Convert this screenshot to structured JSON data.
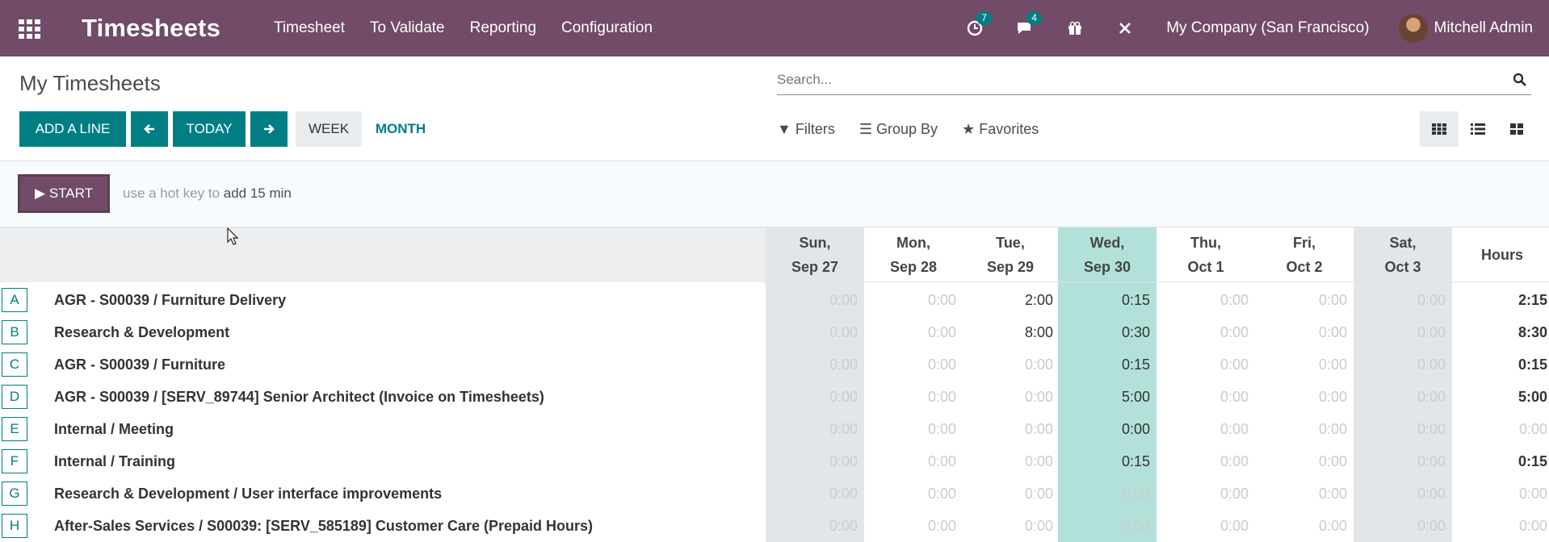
{
  "navbar": {
    "app_title": "Timesheets",
    "menu": [
      "Timesheet",
      "To Validate",
      "Reporting",
      "Configuration"
    ],
    "activity_count": "7",
    "messages_count": "4",
    "company": "My Company (San Francisco)",
    "user": "Mitchell Admin"
  },
  "control": {
    "title": "My Timesheets",
    "search_placeholder": "Search...",
    "add_line": "ADD A LINE",
    "today": "TODAY",
    "week": "WEEK",
    "month": "MONTH",
    "filters": "Filters",
    "group_by": "Group By",
    "favorites": "Favorites"
  },
  "timer": {
    "start": "START",
    "hint_prefix": "use a hot key to",
    "hint_action": "add 15 min"
  },
  "grid": {
    "days": [
      {
        "day": "Sun,",
        "date": "Sep 27"
      },
      {
        "day": "Mon,",
        "date": "Sep 28"
      },
      {
        "day": "Tue,",
        "date": "Sep 29"
      },
      {
        "day": "Wed,",
        "date": "Sep 30"
      },
      {
        "day": "Thu,",
        "date": "Oct 1"
      },
      {
        "day": "Fri,",
        "date": "Oct 2"
      },
      {
        "day": "Sat,",
        "date": "Oct 3"
      }
    ],
    "hours_header": "Hours",
    "rows": [
      {
        "key": "A",
        "label": "AGR - S00039  /  Furniture Delivery",
        "cells": [
          "0:00",
          "0:00",
          "2:00",
          "0:15",
          "0:00",
          "0:00",
          "0:00"
        ],
        "total": "2:15"
      },
      {
        "key": "B",
        "label": "Research & Development",
        "cells": [
          "0:00",
          "0:00",
          "8:00",
          "0:30",
          "0:00",
          "0:00",
          "0:00"
        ],
        "total": "8:30"
      },
      {
        "key": "C",
        "label": "AGR - S00039  /  Furniture",
        "cells": [
          "0:00",
          "0:00",
          "0:00",
          "0:15",
          "0:00",
          "0:00",
          "0:00"
        ],
        "total": "0:15"
      },
      {
        "key": "D",
        "label": "AGR - S00039 / [SERV_89744] Senior Architect (Invoice on Timesheets)",
        "cells": [
          "0:00",
          "0:00",
          "0:00",
          "5:00",
          "0:00",
          "0:00",
          "0:00"
        ],
        "total": "5:00"
      },
      {
        "key": "E",
        "label": "Internal  /  Meeting",
        "cells": [
          "0:00",
          "0:00",
          "0:00",
          "0:00",
          "0:00",
          "0:00",
          "0:00"
        ],
        "total": "0:00"
      },
      {
        "key": "F",
        "label": "Internal  /  Training",
        "cells": [
          "0:00",
          "0:00",
          "0:00",
          "0:15",
          "0:00",
          "0:00",
          "0:00"
        ],
        "total": "0:15"
      },
      {
        "key": "G",
        "label": "Research & Development  /  User interface improvements",
        "cells": [
          "0:00",
          "0:00",
          "0:00",
          "0:00",
          "0:00",
          "0:00",
          "0:00"
        ],
        "total": "0:00"
      },
      {
        "key": "H",
        "label": "After-Sales Services /  S00039: [SERV_585189] Customer Care (Prepaid Hours)",
        "cells": [
          "0:00",
          "0:00",
          "0:00",
          "0:00",
          "0:00",
          "0:00",
          "0:00"
        ],
        "total": "0:00"
      }
    ]
  },
  "colors": {
    "navbar": "#714b67",
    "primary": "#017e84",
    "today_column": "#b2e1da",
    "weekend_column": "#e3e6e8"
  }
}
